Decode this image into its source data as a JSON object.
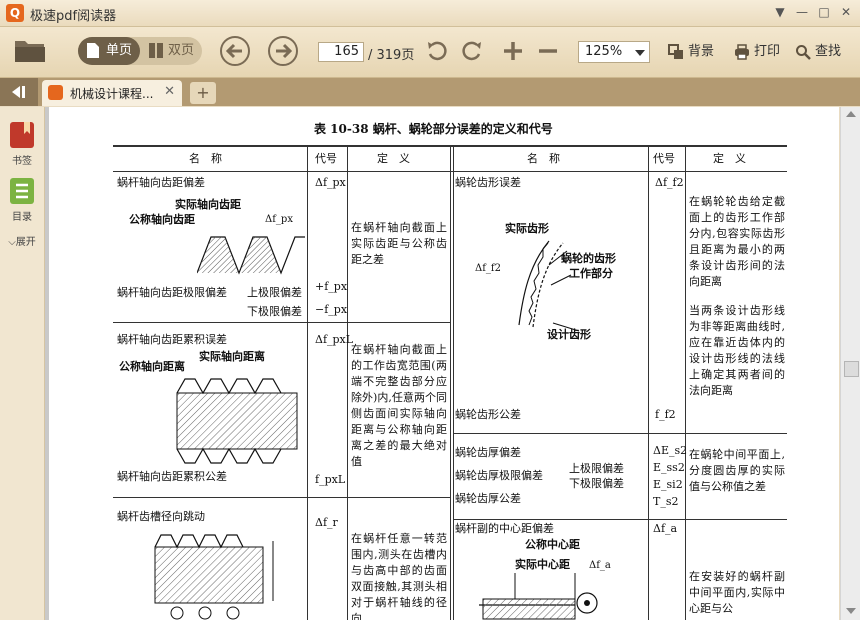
{
  "window": {
    "title": "极速pdf阅读器",
    "min_glyph": "—",
    "max_glyph": "□",
    "close_glyph": "✕",
    "menu_glyph": "▼"
  },
  "toolbar": {
    "single_page": "单页",
    "double_page": "双页",
    "current_page": "165",
    "total_pages": "/ 319页",
    "zoom": "125%",
    "background": "背景",
    "print": "打印",
    "search": "查找"
  },
  "tabs": [
    {
      "label": "机械设计课程..."
    }
  ],
  "sidebar": {
    "bookmark": "书签",
    "toc": "目录",
    "expand": "展开"
  },
  "document": {
    "caption": "表 10-38   蜗杆、蜗轮部分误差的定义和代号",
    "headers": {
      "name": "名　称",
      "code": "代号",
      "definition": "定　义"
    },
    "left_rows": [
      {
        "name": "蜗杆轴向齿距偏差",
        "fig_labels": [
          "实际轴向齿距",
          "公称轴向齿距",
          "Δf_px"
        ],
        "sub_name": "蜗杆轴向齿距极限偏差",
        "sub_labels": [
          "上极限偏差",
          "下极限偏差"
        ],
        "codes": [
          "Δf_px",
          "+f_px",
          "−f_px"
        ],
        "definition": "在蜗杆轴向截面上实际齿距与公称齿距之差"
      },
      {
        "name": "蜗杆轴向齿距累积误差",
        "fig_labels": [
          "实际轴向距离",
          "公称轴向距离"
        ],
        "sub_name": "蜗杆轴向齿距累积公差",
        "codes": [
          "Δf_pxL",
          "f_pxL"
        ],
        "definition": "在蜗杆轴向截面上的工作齿宽范围(两端不完整齿部分应除外)内,任意两个同侧齿面间实际轴向距离与公称轴向距离之差的最大绝对值"
      },
      {
        "name": "蜗杆齿槽径向跳动",
        "codes": [
          "Δf_r"
        ],
        "definition": "在蜗杆任意一转范围内,测头在齿槽内与齿高中部的齿面双面接触,其测头相对于蜗杆轴线的径向"
      }
    ],
    "right_rows": [
      {
        "name": "蜗轮齿形误差",
        "fig_labels": [
          "实际齿形",
          "蜗轮的齿形",
          "工作部分",
          "设计齿形",
          "Δf_f2"
        ],
        "sub_name": "蜗轮齿形公差",
        "codes": [
          "Δf_f2",
          "f_f2"
        ],
        "definition1": "在蜗轮轮齿给定截面上的齿形工作部分内,包容实际齿形且距离为最小的两条设计齿形间的法向距离",
        "definition2": "当两条设计齿形线为非等距离曲线时,应在靠近齿体内的设计齿形线的法线上确定其两者间的法向距离"
      },
      {
        "name": "蜗轮齿厚偏差",
        "sub_name": "蜗轮齿厚极限偏差",
        "sub_labels": [
          "上极限偏差",
          "下极限偏差"
        ],
        "sub_name2": "蜗轮齿厚公差",
        "codes": [
          "ΔE_s2",
          "E_ss2",
          "E_si2",
          "T_s2"
        ],
        "definition": "在蜗轮中间平面上,分度圆齿厚的实际值与公称值之差"
      },
      {
        "name": "蜗杆副的中心距偏差",
        "fig_labels": [
          "公称中心距",
          "实际中心距",
          "Δf_a"
        ],
        "codes": [
          "Δf_a"
        ],
        "definition": "在安装好的蜗杆副中间平面内,实际中心距与公"
      }
    ]
  }
}
